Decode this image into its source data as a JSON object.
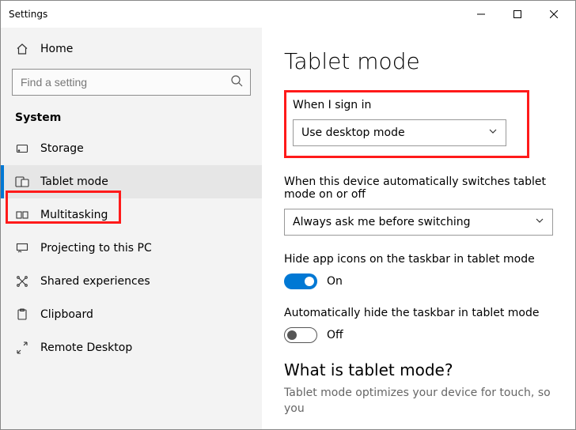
{
  "window": {
    "title": "Settings"
  },
  "sidebar": {
    "home": "Home",
    "search_placeholder": "Find a setting",
    "section": "System",
    "items": [
      {
        "label": "Storage"
      },
      {
        "label": "Tablet mode"
      },
      {
        "label": "Multitasking"
      },
      {
        "label": "Projecting to this PC"
      },
      {
        "label": "Shared experiences"
      },
      {
        "label": "Clipboard"
      },
      {
        "label": "Remote Desktop"
      }
    ]
  },
  "content": {
    "title": "Tablet mode",
    "signin": {
      "label": "When I sign in",
      "value": "Use desktop mode"
    },
    "autoswitch": {
      "label": "When this device automatically switches tablet mode on or off",
      "value": "Always ask me before switching"
    },
    "hide_icons": {
      "label": "Hide app icons on the taskbar in tablet mode",
      "state": "On"
    },
    "hide_taskbar": {
      "label": "Automatically hide the taskbar in tablet mode",
      "state": "Off"
    },
    "what": {
      "heading": "What is tablet mode?",
      "desc": "Tablet mode optimizes your device for touch, so you"
    }
  }
}
